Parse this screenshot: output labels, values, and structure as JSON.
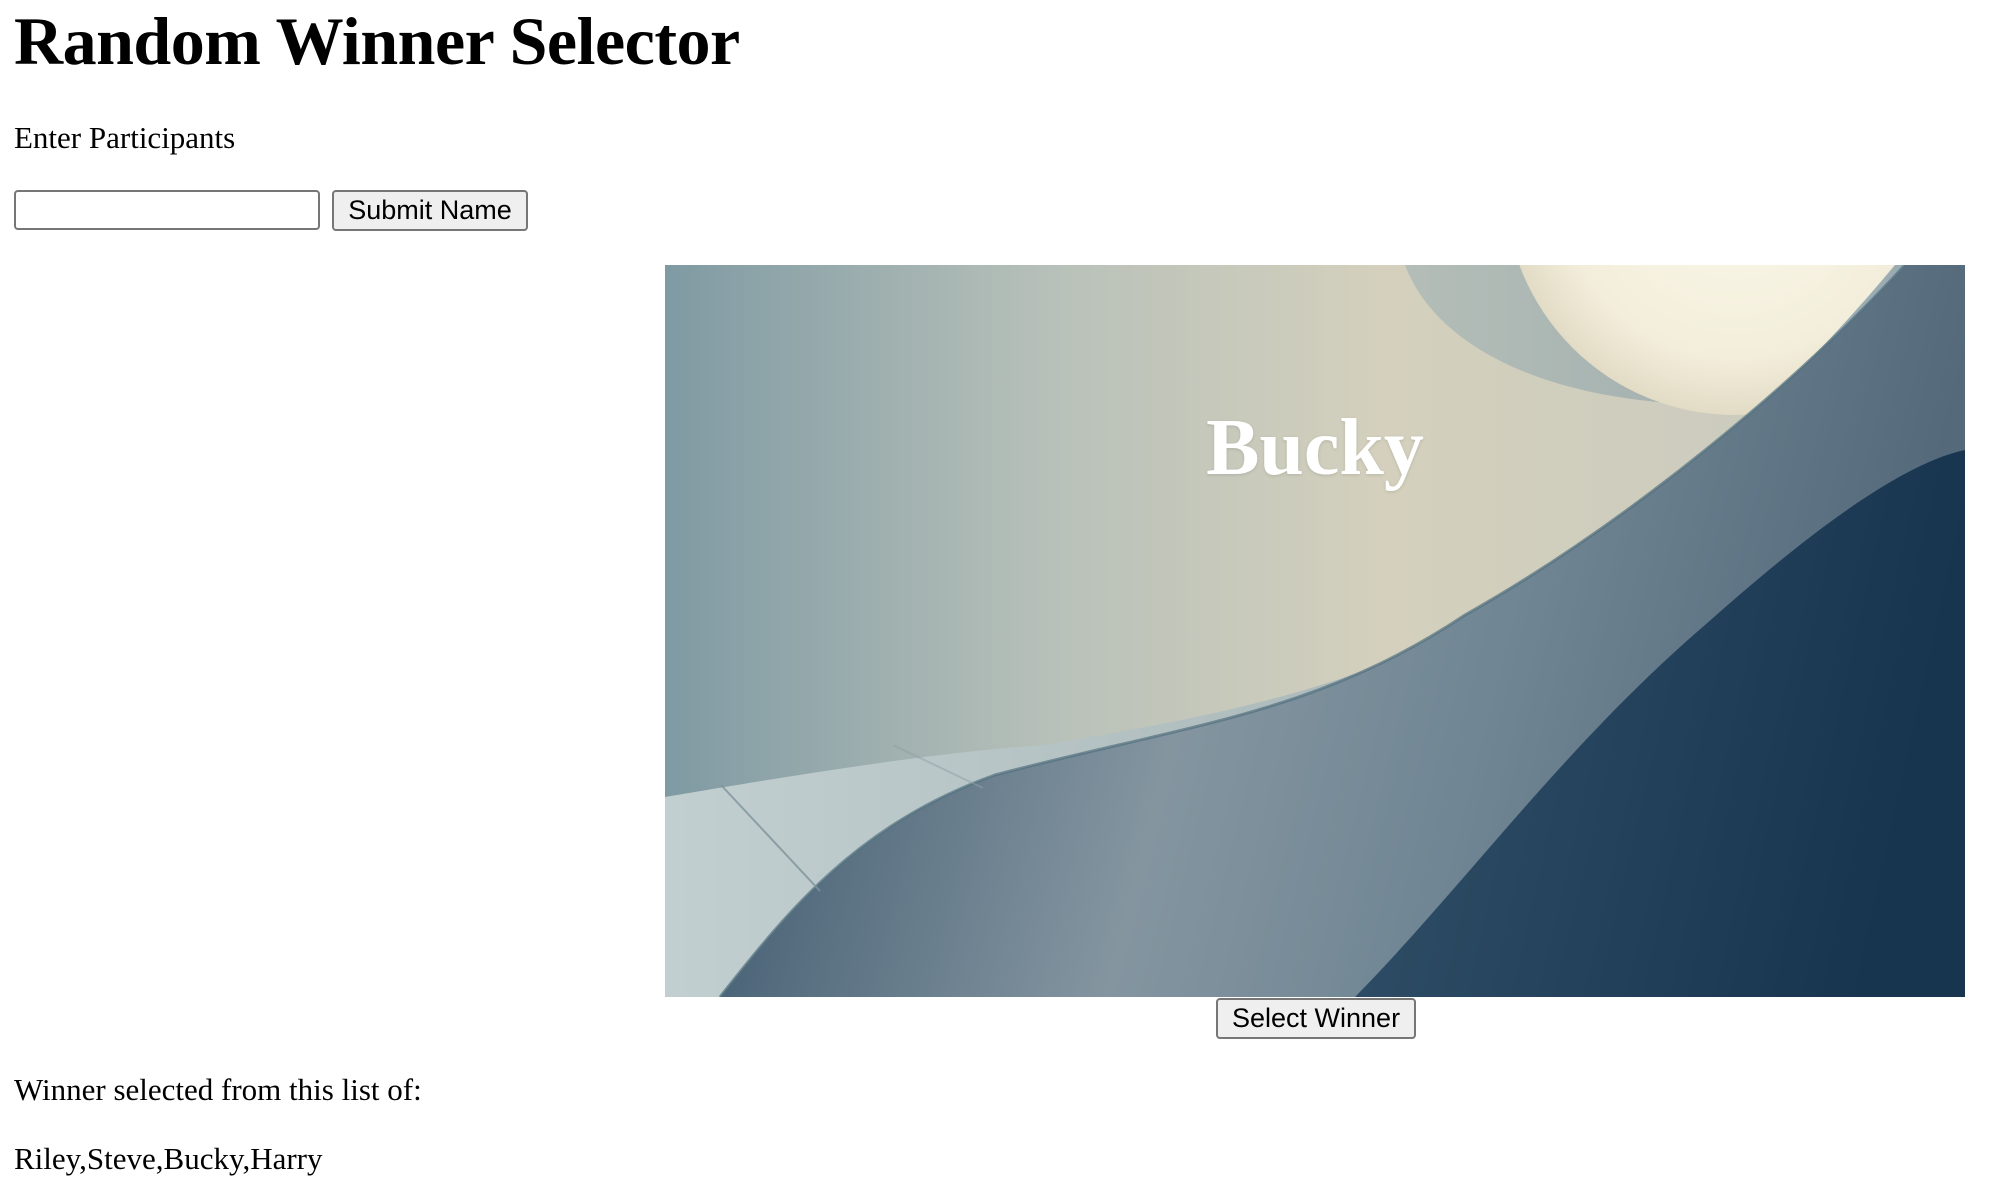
{
  "page": {
    "title": "Random Winner Selector"
  },
  "entry": {
    "label": "Enter Participants",
    "input_value": "",
    "input_placeholder": "",
    "submit_label": "Submit Name"
  },
  "winner": {
    "name": "Bucky",
    "background_image": "abstract-gradient-background",
    "select_label": "Select Winner"
  },
  "participants": {
    "label": "Winner selected from this list of:",
    "list_text": "Riley,Steve,Bucky,Harry"
  }
}
